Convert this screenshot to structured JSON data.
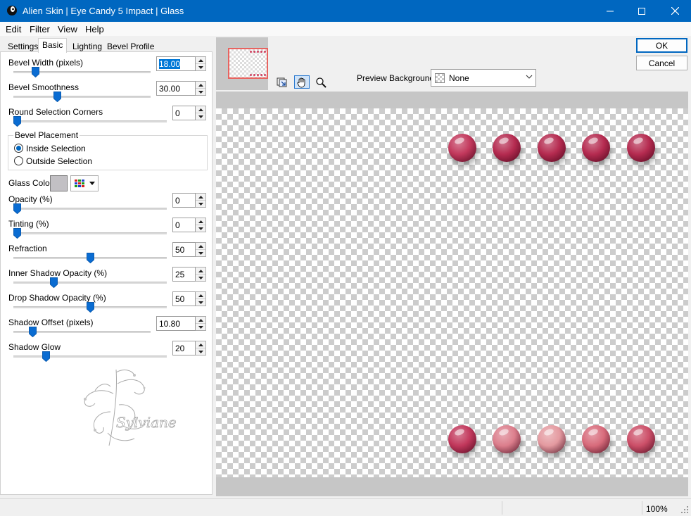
{
  "window": {
    "title": "Alien Skin | Eye Candy 5 Impact | Glass",
    "controls": [
      "minimize-icon",
      "maximize-icon",
      "close-icon"
    ]
  },
  "menu": [
    "Edit",
    "Filter",
    "View",
    "Help"
  ],
  "tabs": [
    "Settings",
    "Basic",
    "Lighting",
    "Bevel Profile"
  ],
  "active_tab": "Basic",
  "controls": {
    "bevel_width": {
      "label": "Bevel Width (pixels)",
      "value": "18.00",
      "slider_fraction": 0.14
    },
    "bevel_smoothness": {
      "label": "Bevel Smoothness",
      "value": "30.00",
      "slider_fraction": 0.31
    },
    "round_corners": {
      "label": "Round Selection Corners",
      "value": "0",
      "slider_fraction": 0.0
    },
    "opacity": {
      "label": "Opacity (%)",
      "value": "0",
      "slider_fraction": 0.0
    },
    "tinting": {
      "label": "Tinting (%)",
      "value": "0",
      "slider_fraction": 0.0
    },
    "refraction": {
      "label": "Refraction",
      "value": "50",
      "slider_fraction": 0.5
    },
    "inner_shadow": {
      "label": "Inner Shadow Opacity (%)",
      "value": "25",
      "slider_fraction": 0.25
    },
    "drop_shadow": {
      "label": "Drop Shadow Opacity (%)",
      "value": "50",
      "slider_fraction": 0.5
    },
    "shadow_offset": {
      "label": "Shadow Offset (pixels)",
      "value": "10.80",
      "slider_fraction": 0.12
    },
    "shadow_glow": {
      "label": "Shadow Glow",
      "value": "20",
      "slider_fraction": 0.2
    }
  },
  "bevel_placement": {
    "legend": "Bevel Placement",
    "options": [
      "Inside Selection",
      "Outside Selection"
    ],
    "selected": "Inside Selection"
  },
  "glass_color": {
    "label": "Glass Color",
    "color": "#c2c0c4"
  },
  "buttons": {
    "ok": "OK",
    "cancel": "Cancel"
  },
  "preview_background": {
    "label": "Preview Background:",
    "value": "None"
  },
  "tools": [
    "navigator-icon",
    "hand-icon",
    "zoom-icon"
  ],
  "beads": {
    "top": [
      "#c2385c",
      "#b52b50",
      "#b52b50",
      "#b52b50",
      "#b52b50"
    ],
    "bottom": [
      "#c2385c",
      "#dc7e8c",
      "#e49aa0",
      "#d86b7b",
      "#cc4f68"
    ]
  },
  "status": {
    "zoom": "100%"
  },
  "watermark": "Sylviane",
  "colors": {
    "titlebar": "#0067c0",
    "accent": "#0067c0",
    "frame": "#e8635f"
  }
}
